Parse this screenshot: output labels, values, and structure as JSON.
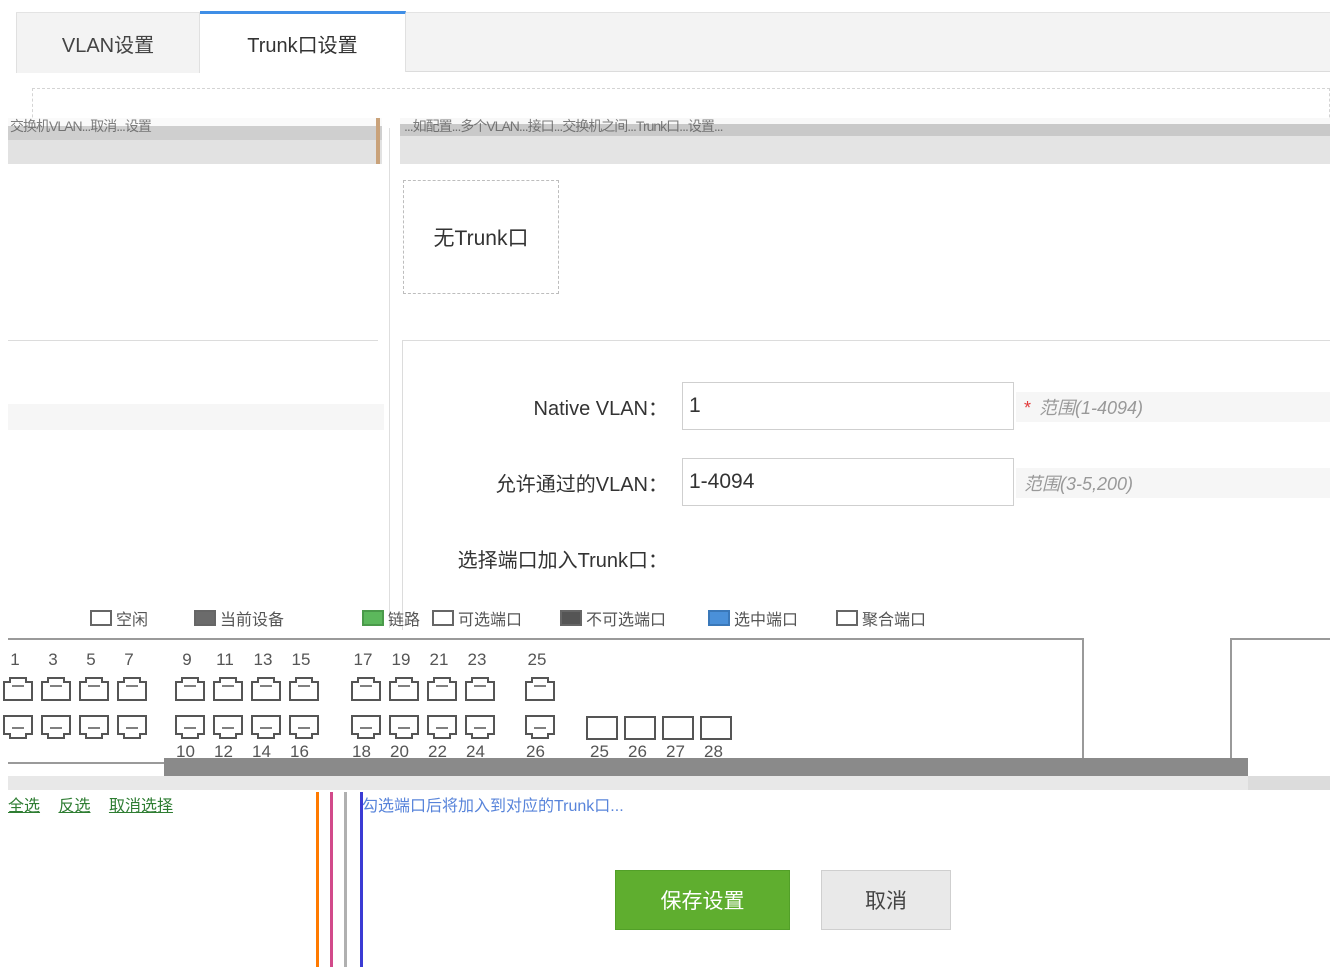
{
  "tabs": [
    {
      "label": "VLAN设置",
      "active": false
    },
    {
      "label": "Trunk口设置",
      "active": true
    }
  ],
  "top_notice": {
    "left_text": "交换机VLAN...取消...设置",
    "right_text": "...如配置...多个VLAN...接口...交换机之间...Trunk口...设置..."
  },
  "trunk_list": {
    "empty_text": "无Trunk口"
  },
  "form": {
    "native_vlan_label": "Native VLAN：",
    "native_vlan_value": "1",
    "native_vlan_hint": "范围(1-4094)",
    "native_vlan_required": "*",
    "allowed_vlan_label": "允许通过的VLAN：",
    "allowed_vlan_value": "1-4094",
    "allowed_vlan_hint": "范围(3-5,200)",
    "select_ports_label": "选择端口加入Trunk口："
  },
  "legend": [
    {
      "label": "空闲",
      "color": "#ffffff"
    },
    {
      "label": "当前设备",
      "color": "#6b6b6b"
    },
    {
      "label": "链路",
      "color": "#5cb85c"
    },
    {
      "label": "可选端口",
      "color": "#ffffff"
    },
    {
      "label": "不可选端口",
      "color": "#555555"
    },
    {
      "label": "选中端口",
      "color": "#4a90d9"
    },
    {
      "label": "聚合端口",
      "color": "#ffffff"
    }
  ],
  "ports": {
    "top_numbers": [
      "1",
      "3",
      "5",
      "7",
      "9",
      "11",
      "13",
      "15",
      "17",
      "19",
      "21",
      "23",
      "25"
    ],
    "bottom_numbers": [
      "10",
      "12",
      "14",
      "16",
      "18",
      "20",
      "22",
      "24",
      "26",
      "25",
      "26",
      "27",
      "28"
    ]
  },
  "select_links": [
    "全选",
    "反选",
    "取消选择"
  ],
  "bottom_notice": "勾选端口后将加入到对应的Trunk口...",
  "buttons": {
    "save": "保存设置",
    "cancel": "取消"
  },
  "colors": {
    "accent": "#3f8ee6",
    "save_green": "#5fae2f",
    "hint_gray": "#999999",
    "required_red": "#e23b3b"
  }
}
